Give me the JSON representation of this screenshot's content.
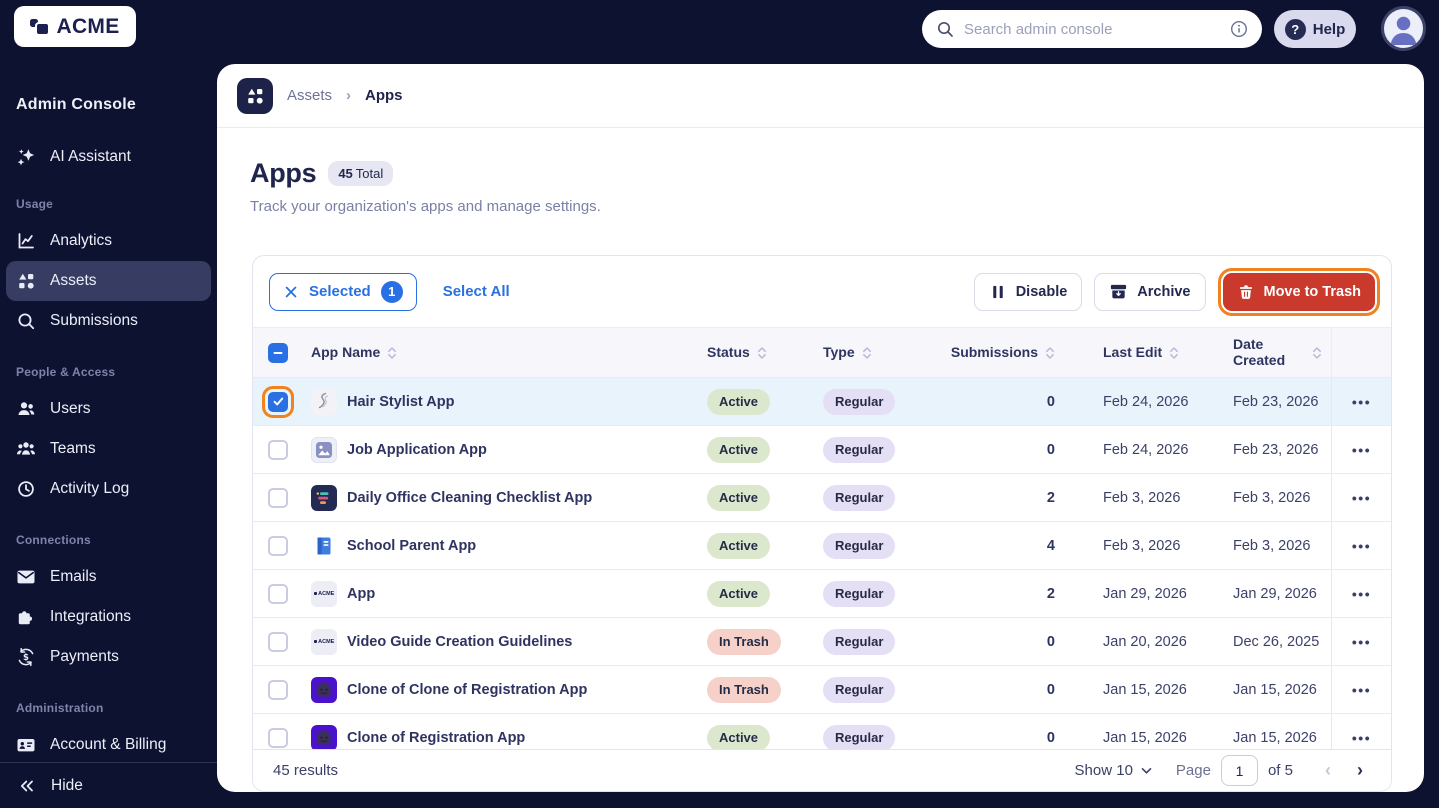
{
  "topbar": {
    "logo_text": "ACME",
    "search_placeholder": "Search admin console",
    "help_label": "Help"
  },
  "sidebar": {
    "title": "Admin Console",
    "assistant_label": "AI Assistant",
    "sections": [
      {
        "label": "Usage",
        "items": [
          {
            "label": "Analytics",
            "icon": "analytics",
            "active": false
          },
          {
            "label": "Assets",
            "icon": "assets",
            "active": true
          },
          {
            "label": "Submissions",
            "icon": "search",
            "active": false
          }
        ]
      },
      {
        "label": "People & Access",
        "items": [
          {
            "label": "Users",
            "icon": "users",
            "active": false
          },
          {
            "label": "Teams",
            "icon": "teams",
            "active": false
          },
          {
            "label": "Activity Log",
            "icon": "activity",
            "active": false
          }
        ]
      },
      {
        "label": "Connections",
        "items": [
          {
            "label": "Emails",
            "icon": "mail",
            "active": false
          },
          {
            "label": "Integrations",
            "icon": "puzzle",
            "active": false
          },
          {
            "label": "Payments",
            "icon": "payments",
            "active": false
          }
        ]
      },
      {
        "label": "Administration",
        "items": [
          {
            "label": "Account & Billing",
            "icon": "card",
            "active": false
          }
        ]
      }
    ],
    "hide_label": "Hide"
  },
  "breadcrumb": {
    "parent": "Assets",
    "current": "Apps"
  },
  "page": {
    "title": "Apps",
    "badge_number": "45",
    "badge_label": "Total",
    "subtitle": "Track your organization's apps and manage settings."
  },
  "toolbar": {
    "selected_label": "Selected",
    "selected_count": "1",
    "select_all_label": "Select All",
    "disable_label": "Disable",
    "archive_label": "Archive",
    "move_to_trash_label": "Move to Trash"
  },
  "table": {
    "columns": [
      "App Name",
      "Status",
      "Type",
      "Submissions",
      "Last Edit",
      "Date Created"
    ],
    "rows": [
      {
        "name": "Hair Stylist App",
        "icon": "swirl",
        "status": "Active",
        "type": "Regular",
        "submissions": "0",
        "last_edit": "Feb 24, 2026",
        "date_created": "Feb 23, 2026",
        "checked": true
      },
      {
        "name": "Job Application App",
        "icon": "photo",
        "status": "Active",
        "type": "Regular",
        "submissions": "0",
        "last_edit": "Feb 24, 2026",
        "date_created": "Feb 23, 2026",
        "checked": false
      },
      {
        "name": "Daily Office Cleaning Checklist App",
        "icon": "bars",
        "status": "Active",
        "type": "Regular",
        "submissions": "2",
        "last_edit": "Feb 3, 2026",
        "date_created": "Feb 3, 2026",
        "checked": false
      },
      {
        "name": "School Parent App",
        "icon": "book",
        "status": "Active",
        "type": "Regular",
        "submissions": "4",
        "last_edit": "Feb 3, 2026",
        "date_created": "Feb 3, 2026",
        "checked": false
      },
      {
        "name": "App",
        "icon": "acme",
        "status": "Active",
        "type": "Regular",
        "submissions": "2",
        "last_edit": "Jan 29, 2026",
        "date_created": "Jan 29, 2026",
        "checked": false
      },
      {
        "name": "Video Guide Creation Guidelines",
        "icon": "acme",
        "status": "In Trash",
        "type": "Regular",
        "submissions": "0",
        "last_edit": "Jan 20, 2026",
        "date_created": "Dec 26, 2025",
        "checked": false
      },
      {
        "name": "Clone of Clone of Registration App",
        "icon": "lego",
        "status": "In Trash",
        "type": "Regular",
        "submissions": "0",
        "last_edit": "Jan 15, 2026",
        "date_created": "Jan 15, 2026",
        "checked": false
      },
      {
        "name": "Clone of Registration App",
        "icon": "lego",
        "status": "Active",
        "type": "Regular",
        "submissions": "0",
        "last_edit": "Jan 15, 2026",
        "date_created": "Jan 15, 2026",
        "checked": false
      }
    ]
  },
  "footer": {
    "results": "45 results",
    "show_label": "Show 10",
    "page_label": "Page",
    "page_value": "1",
    "of_label": "of 5"
  },
  "colors": {
    "navy": "#0e1231",
    "accent_blue": "#2970e4",
    "danger_red": "#c9392c",
    "annotation_orange": "#f0831f",
    "selected_row": "#e9f3fc",
    "pill_active": "#dce8cd",
    "pill_in_trash": "#f5d1c9",
    "pill_regular": "#e5dff6"
  }
}
